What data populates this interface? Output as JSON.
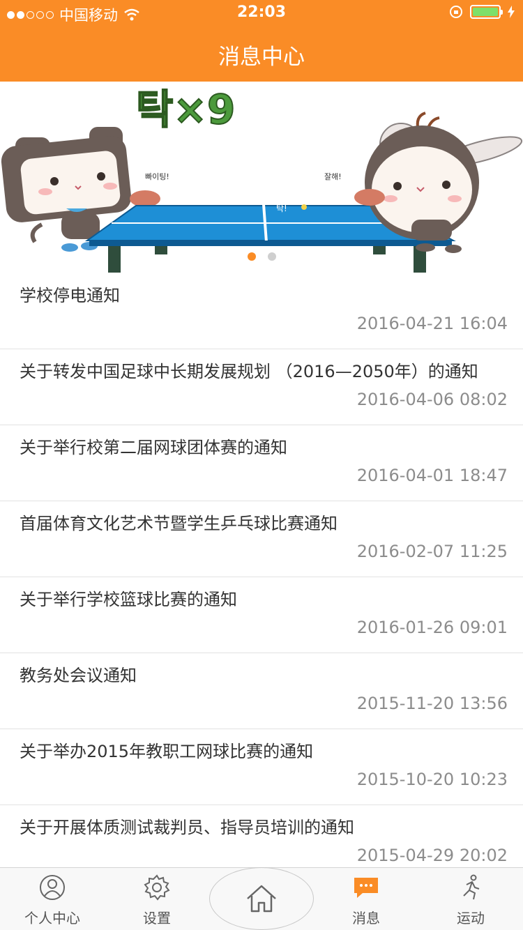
{
  "status_bar": {
    "carrier": "中国移动",
    "time": "22:03"
  },
  "header": {
    "title": "消息中心"
  },
  "banner": {
    "text": "탁×9",
    "left_speech": "빠이팅!",
    "right_speech": "잘해!",
    "net_text": "탁!",
    "page_count": 2,
    "active_page": 1
  },
  "messages": [
    {
      "title": "学校停电通知",
      "time": "2016-04-21 16:04"
    },
    {
      "title": "关于转发中国足球中长期发展规划 （2016—2050年）的通知",
      "time": "2016-04-06 08:02"
    },
    {
      "title": "关于举行校第二届网球团体赛的通知",
      "time": "2016-04-01 18:47"
    },
    {
      "title": "首届体育文化艺术节暨学生乒乓球比赛通知",
      "time": "2016-02-07 11:25"
    },
    {
      "title": "关于举行学校篮球比赛的通知",
      "time": "2016-01-26 09:01"
    },
    {
      "title": "教务处会议通知",
      "time": "2015-11-20 13:56"
    },
    {
      "title": "关于举办2015年教职工网球比赛的通知",
      "time": "2015-10-20 10:23"
    },
    {
      "title": "关于开展体质测试裁判员、指导员培训的通知",
      "time": "2015-04-29 20:02"
    }
  ],
  "tabbar": {
    "personal": {
      "label": "个人中心",
      "icon": "user-icon"
    },
    "settings": {
      "label": "设置",
      "icon": "gear-icon"
    },
    "home": {
      "icon": "home-icon"
    },
    "messages": {
      "label": "消息",
      "icon": "message-icon"
    },
    "sport": {
      "label": "运动",
      "icon": "running-icon"
    }
  },
  "colors": {
    "accent": "#fa8c26",
    "battery": "#7ee06a",
    "table": "#1e8fd6"
  }
}
